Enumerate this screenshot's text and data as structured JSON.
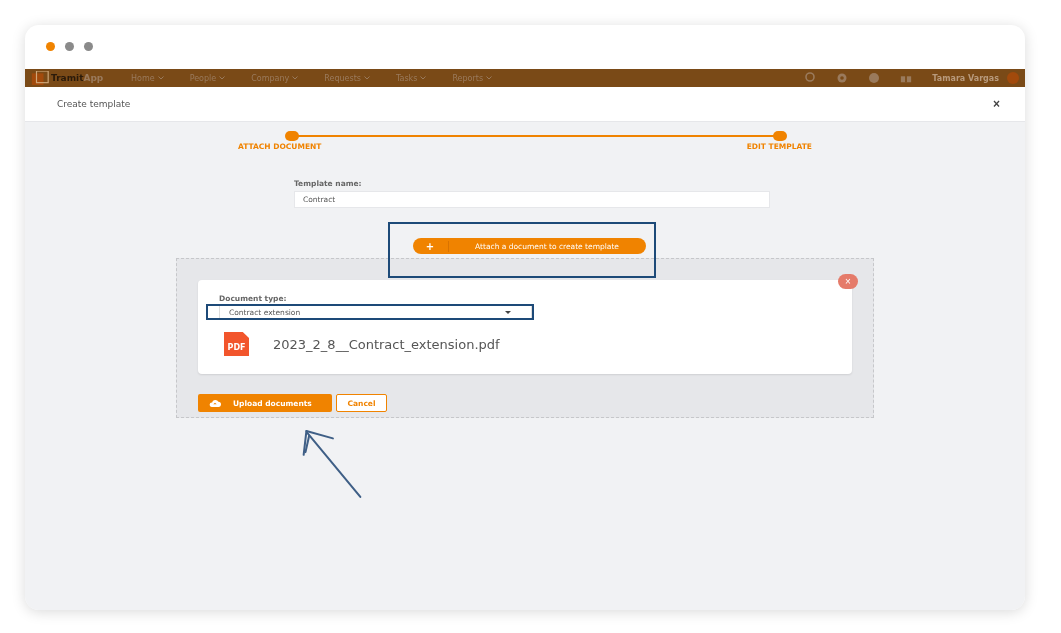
{
  "app_bar": {
    "logo": {
      "primary": "Tramit",
      "secondary": "App"
    },
    "nav": [
      "Home",
      "People",
      "Company",
      "Requests",
      "Tasks",
      "Reports"
    ],
    "user": "Tamara Vargas"
  },
  "modal": {
    "title": "Create template",
    "close": "×",
    "steps": [
      "ATTACH DOCUMENT",
      "EDIT TEMPLATE"
    ],
    "template_name": {
      "label": "Template name:",
      "value": "Contract"
    },
    "attach_button": {
      "icon": "+",
      "label": "Attach a document to create template"
    },
    "document": {
      "type_label": "Document type:",
      "type_value": "Contract extension",
      "file_badge": "PDF",
      "file_name": "2023_2_8__Contract_extension.pdf",
      "remove": "×"
    },
    "buttons": [
      {
        "kind": "primary",
        "label": "Upload documents"
      },
      {
        "kind": "outline",
        "label": "Cancel"
      }
    ]
  }
}
